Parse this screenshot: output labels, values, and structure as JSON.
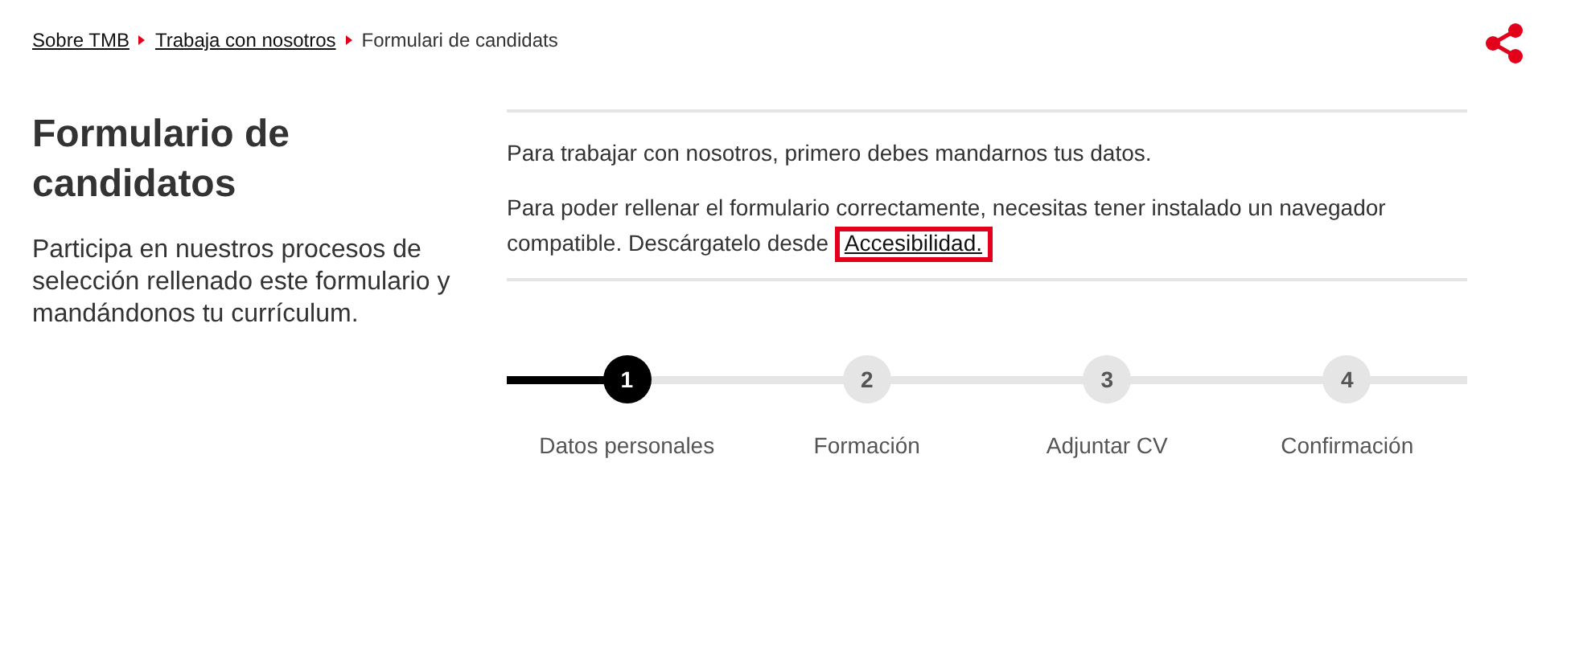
{
  "breadcrumb": [
    {
      "label": "Sobre TMB",
      "link": true
    },
    {
      "label": "Trabaja con nosotros",
      "link": true
    },
    {
      "label": "Formulari de candidats",
      "link": false
    }
  ],
  "title": "Formulario de candidatos",
  "description": "Participa en nuestros procesos de selección rellenado este formulario y mandándonos tu currículum.",
  "intro": "Para trabajar con nosotros, primero debes mandarnos tus datos.",
  "notice": {
    "text": "Para poder rellenar el formulario correctamente, necesitas tener instalado un navegador compatible. Descárgatelo desde",
    "link": "Accesibilidad.",
    "highlighted": true
  },
  "steps": [
    {
      "number": "1",
      "label": "Datos personales",
      "selected": true
    },
    {
      "number": "2",
      "label": "Formación",
      "selected": false
    },
    {
      "number": "3",
      "label": "Adjuntar CV",
      "selected": false
    },
    {
      "number": "4",
      "label": "Confirmación",
      "selected": false
    }
  ]
}
